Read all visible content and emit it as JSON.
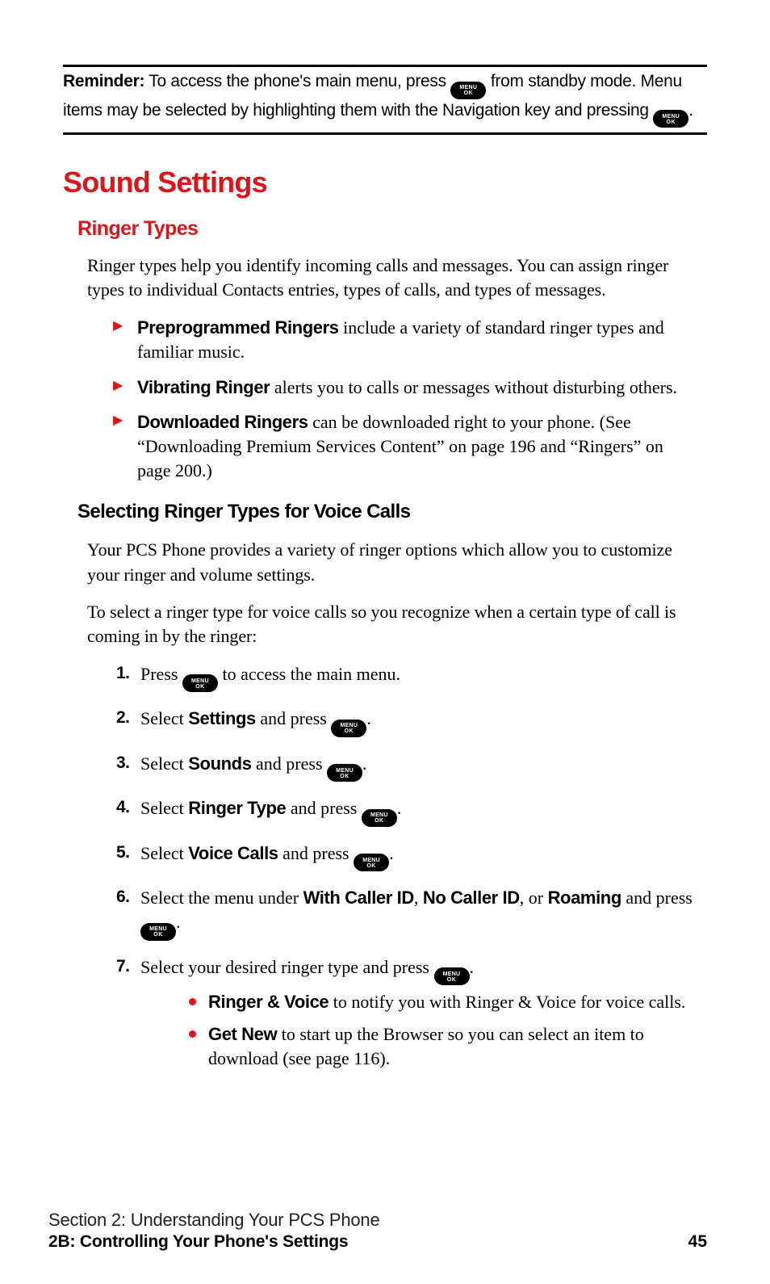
{
  "key_label": {
    "top": "MENU",
    "bottom": "OK"
  },
  "reminder": {
    "label": "Reminder:",
    "part1": " To access the phone's main menu, press ",
    "part2": " from standby mode. Menu items may be selected by highlighting them with the Navigation key and pressing ",
    "part3": "."
  },
  "h1": "Sound Settings",
  "h2": "Ringer Types",
  "intro": "Ringer types help you identify incoming calls and messages. You can assign ringer types to individual Contacts entries, types of calls, and types of messages.",
  "triangles": [
    {
      "bold": "Preprogrammed Ringers",
      "rest": " include a variety of standard ringer types and familiar music."
    },
    {
      "bold": "Vibrating Ringer",
      "rest": " alerts you to calls or messages without disturbing others."
    },
    {
      "bold": "Downloaded Ringers",
      "rest": " can be downloaded right to your phone. (See “Downloading Premium Services Content” on page 196 and “Ringers” on page 200.)"
    }
  ],
  "h3": "Selecting Ringer Types for Voice Calls",
  "para2": "Your PCS Phone provides a variety of ringer options which allow you to customize your ringer and volume settings.",
  "para3": "To select a ringer type for voice calls so you recognize when a certain type of call is coming in by the ringer:",
  "steps": {
    "s1": {
      "num": "1.",
      "a": "Press ",
      "b": " to access the main menu."
    },
    "s2": {
      "num": "2.",
      "a": "Select ",
      "bold": "Settings",
      "b": " and press ",
      "c": "."
    },
    "s3": {
      "num": "3.",
      "a": "Select ",
      "bold": "Sounds",
      "b": " and press ",
      "c": "."
    },
    "s4": {
      "num": "4.",
      "a": "Select ",
      "bold": "Ringer Type",
      "b": " and press ",
      "c": "."
    },
    "s5": {
      "num": "5.",
      "a": "Select ",
      "bold": "Voice Calls",
      "b": " and press ",
      "c": "."
    },
    "s6": {
      "num": "6.",
      "a": "Select the menu under ",
      "b1": "With Caller ID",
      "sep1": ", ",
      "b2": "No Caller ID",
      "sep2": ", or ",
      "b3": "Roaming",
      "c": " and press ",
      "d": "."
    },
    "s7": {
      "num": "7.",
      "a": "Select your desired ringer type and press ",
      "b": "."
    }
  },
  "dots": [
    {
      "bold": "Ringer & Voice",
      "rest": " to notify you with Ringer & Voice for voice calls."
    },
    {
      "bold": "Get New",
      "rest": " to start up the Browser so you can select an item to download (see page 116)."
    }
  ],
  "footer": {
    "line1": "Section 2: Understanding Your PCS Phone",
    "line2": "2B: Controlling Your Phone's Settings",
    "page": "45"
  }
}
